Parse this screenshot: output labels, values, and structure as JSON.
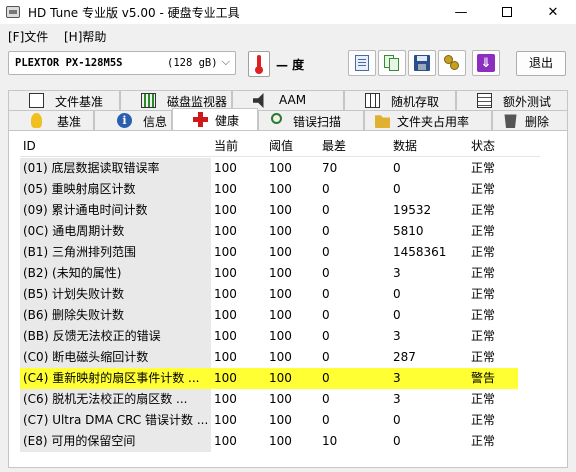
{
  "window": {
    "title": "HD Tune 专业版 v5.00 - 硬盘专业工具",
    "minimize": "—",
    "close": "✕"
  },
  "menu": {
    "file": "[F]文件",
    "help": "[H]帮助"
  },
  "toolbar": {
    "drive_name": "PLEXTOR PX-128M5S",
    "drive_size": "(128 gB)",
    "temperature": "— 度",
    "exit_label": "退出"
  },
  "tabs_row1": [
    {
      "label": "文件基准",
      "icon": "document-icon"
    },
    {
      "label": "磁盘监视器",
      "icon": "bar-chart-icon"
    },
    {
      "label": "AAM",
      "icon": "speaker-icon"
    },
    {
      "label": "随机存取",
      "icon": "grid-icon"
    },
    {
      "label": "额外测试",
      "icon": "list-icon"
    }
  ],
  "tabs_row2": [
    {
      "label": "基准",
      "icon": "bulb-icon"
    },
    {
      "label": "信息",
      "icon": "info-icon"
    },
    {
      "label": "健康",
      "icon": "health-plus-icon",
      "active": true
    },
    {
      "label": "错误扫描",
      "icon": "magnifier-icon"
    },
    {
      "label": "文件夹占用率",
      "icon": "folder-icon"
    },
    {
      "label": "删除",
      "icon": "trash-icon"
    }
  ],
  "table": {
    "columns": [
      "ID",
      "当前",
      "阈值",
      "最差",
      "数据",
      "状态"
    ],
    "rows": [
      {
        "id": "(01) 底层数据读取错误率",
        "current": "100",
        "threshold": "100",
        "worst": "70",
        "data": "0",
        "status": "正常"
      },
      {
        "id": "(05) 重映射扇区计数",
        "current": "100",
        "threshold": "100",
        "worst": "0",
        "data": "0",
        "status": "正常"
      },
      {
        "id": "(09) 累计通电时间计数",
        "current": "100",
        "threshold": "100",
        "worst": "0",
        "data": "19532",
        "status": "正常"
      },
      {
        "id": "(0C) 通电周期计数",
        "current": "100",
        "threshold": "100",
        "worst": "0",
        "data": "5810",
        "status": "正常"
      },
      {
        "id": "(B1) 三角洲排列范围",
        "current": "100",
        "threshold": "100",
        "worst": "0",
        "data": "1458361",
        "status": "正常"
      },
      {
        "id": "(B2) (未知的属性)",
        "current": "100",
        "threshold": "100",
        "worst": "0",
        "data": "3",
        "status": "正常"
      },
      {
        "id": "(B5) 计划失败计数",
        "current": "100",
        "threshold": "100",
        "worst": "0",
        "data": "0",
        "status": "正常"
      },
      {
        "id": "(B6) 删除失败计数",
        "current": "100",
        "threshold": "100",
        "worst": "0",
        "data": "0",
        "status": "正常"
      },
      {
        "id": "(BB) 反馈无法校正的错误",
        "current": "100",
        "threshold": "100",
        "worst": "0",
        "data": "3",
        "status": "正常"
      },
      {
        "id": "(C0) 断电磁头缩回计数",
        "current": "100",
        "threshold": "100",
        "worst": "0",
        "data": "287",
        "status": "正常"
      },
      {
        "id": "(C4) 重新映射的扇区事件计数 ...",
        "current": "100",
        "threshold": "100",
        "worst": "0",
        "data": "3",
        "status": "警告",
        "warning": true
      },
      {
        "id": "(C6) 脱机无法校正的扇区数 ...",
        "current": "100",
        "threshold": "100",
        "worst": "0",
        "data": "3",
        "status": "正常"
      },
      {
        "id": "(C7) Ultra DMA CRC 错误计数 ...",
        "current": "100",
        "threshold": "100",
        "worst": "0",
        "data": "0",
        "status": "正常"
      },
      {
        "id": "(E8) 可用的保留空间",
        "current": "100",
        "threshold": "100",
        "worst": "10",
        "data": "0",
        "status": "正常"
      }
    ]
  },
  "colors": {
    "warning_highlight": "#ffff33",
    "id_column_bg": "#e9e9e9"
  }
}
